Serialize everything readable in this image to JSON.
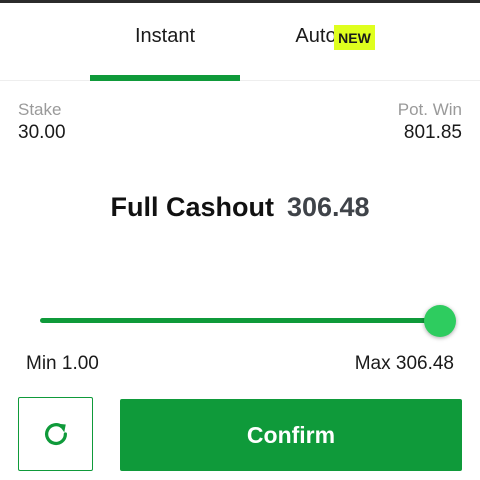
{
  "tabs": [
    {
      "label": "Instant",
      "active": true
    },
    {
      "label": "Auto",
      "badge": "NEW",
      "active": false
    }
  ],
  "colors": {
    "accent": "#0f9a3a",
    "slider_thumb": "#2ecc5f",
    "badge_bg": "#dfff1e",
    "muted_text": "#9a9a9a"
  },
  "stake": {
    "label": "Stake",
    "value": "30.00"
  },
  "pot_win": {
    "label": "Pot. Win",
    "value": "801.85"
  },
  "cashout": {
    "label": "Full Cashout",
    "value": "306.48"
  },
  "slider": {
    "min": 1.0,
    "max": 306.48,
    "value": 306.48
  },
  "range": {
    "min_label": "Min 1.00",
    "max_label": "Max 306.48"
  },
  "actions": {
    "refresh_icon": "refresh-icon",
    "confirm_label": "Confirm"
  }
}
